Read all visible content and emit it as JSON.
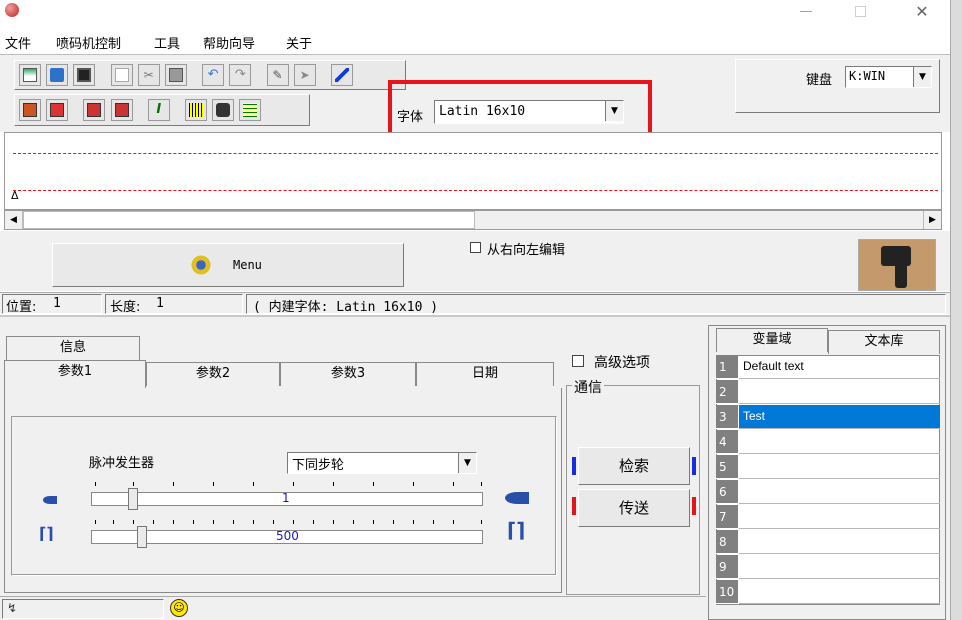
{
  "menu": {
    "items": [
      "文件",
      "喷码机控制",
      "工具",
      "帮助向导",
      "关于"
    ]
  },
  "font_selector": {
    "label": "字体",
    "value": "Latin 16x10"
  },
  "keyboard": {
    "label": "键盘",
    "value": "K:WIN"
  },
  "editor": {
    "cursor_marker": "Δ"
  },
  "menu_button": {
    "label": "Menu"
  },
  "rtl_checkbox": {
    "label": "从右向左编辑",
    "checked": false
  },
  "status": {
    "position_label": "位置:",
    "position_value": "1",
    "length_label": "长度:",
    "length_value": "1",
    "builtin_font": "( 内建字体: Latin 16x10 )"
  },
  "tabs": {
    "top": [
      "信息"
    ],
    "main": [
      "参数1",
      "参数2",
      "参数3",
      "日期"
    ],
    "active": "参数1"
  },
  "params": {
    "pulse_label": "脉冲发生器",
    "pulse_value": "下同步轮",
    "slider1_value": "1",
    "slider2_value": "500"
  },
  "advanced": {
    "label": "高级选项",
    "checked": false
  },
  "comm": {
    "group_label": "通信",
    "search_button": "检索",
    "send_button": "传送"
  },
  "library": {
    "tabs": [
      "变量域",
      "文本库"
    ],
    "rows": [
      {
        "num": "1",
        "text": "Default text"
      },
      {
        "num": "2",
        "text": ""
      },
      {
        "num": "3",
        "text": "Test"
      },
      {
        "num": "4",
        "text": ""
      },
      {
        "num": "5",
        "text": ""
      },
      {
        "num": "6",
        "text": ""
      },
      {
        "num": "7",
        "text": ""
      },
      {
        "num": "8",
        "text": ""
      },
      {
        "num": "9",
        "text": ""
      },
      {
        "num": "10",
        "text": ""
      }
    ],
    "selected_index": 2
  },
  "colors": {
    "highlight_box": "#e8141b",
    "selection": "#0078d7",
    "dash_line": "#e8141b",
    "slider_value": "#1a1ac8"
  }
}
